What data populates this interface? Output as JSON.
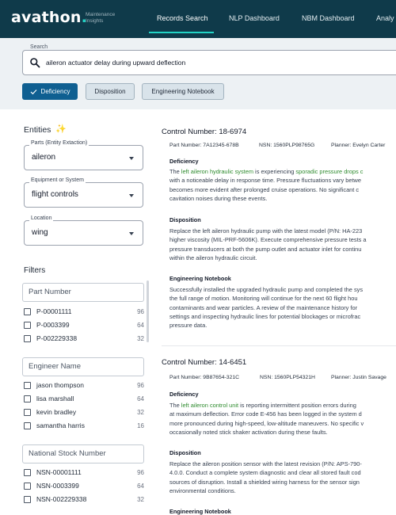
{
  "app": {
    "logo": "avathon",
    "logo_dot": ".",
    "subtitle_line1": "Maintenance",
    "subtitle_line2": "Insights"
  },
  "nav": {
    "tabs": [
      {
        "label": "Records Search",
        "active": true
      },
      {
        "label": "NLP Dashboard",
        "active": false
      },
      {
        "label": "NBM Dashboard",
        "active": false
      },
      {
        "label": "Analy",
        "active": false
      }
    ],
    "accent_color": "#22d3c5"
  },
  "search": {
    "label": "Search",
    "value": "aileron actuator delay during upward deflection",
    "icon": "search-icon"
  },
  "chips": [
    {
      "label": "Deficiency",
      "selected": true,
      "icon": "check-icon"
    },
    {
      "label": "Disposition",
      "selected": false
    },
    {
      "label": "Engineering Notebook",
      "selected": false
    }
  ],
  "entities": {
    "title": "Entities",
    "icon": "sparkle-icon",
    "fields": [
      {
        "label": "Parts (Entity Extaction)",
        "value": "aileron"
      },
      {
        "label": "Equipment or System",
        "value": "flight controls"
      },
      {
        "label": "Location",
        "value": "wing"
      }
    ]
  },
  "filters": {
    "title": "Filters",
    "groups": [
      {
        "placeholder": "Part Number",
        "items": [
          {
            "label": "P-00001111",
            "count": "96"
          },
          {
            "label": "P-0003399",
            "count": "64"
          },
          {
            "label": "P-002229338",
            "count": "32"
          }
        ]
      },
      {
        "placeholder": "Engineer Name",
        "items": [
          {
            "label": "jason thompson",
            "count": "96"
          },
          {
            "label": "lisa marshall",
            "count": "64"
          },
          {
            "label": "kevin bradley",
            "count": "32"
          },
          {
            "label": "samantha harris",
            "count": "16"
          }
        ]
      },
      {
        "placeholder": "National Stock Number",
        "items": [
          {
            "label": "NSN-00001111",
            "count": "96"
          },
          {
            "label": "NSN-0003399",
            "count": "64"
          },
          {
            "label": "NSN-002229338",
            "count": "32"
          }
        ]
      }
    ]
  },
  "records": [
    {
      "title": "Control Number: 18-6974",
      "part_number": "Part Number: 7A12345-678B",
      "nsn": "NSN: 1560PLP98765G",
      "planner": "Planner: Evelyn Carter",
      "deficiency_heading": "Deficiency",
      "deficiency_pre": "The ",
      "deficiency_hl1": "left aileron hydraulic system",
      "deficiency_mid": " is experiencing ",
      "deficiency_hl2": "sporadic pressure drops c",
      "deficiency_lines": [
        "with a noticeable delay in response time. Pressure fluctuations vary betwe",
        "becomes more evident after prolonged cruise operations. No significant c",
        "cavitation noises during these events."
      ],
      "disposition_heading": "Disposition",
      "disposition_lines": [
        "Replace the left aileron hydraulic pump with the latest model (P/N: HA-223",
        "higher viscosity (MIL-PRF-5606K). Execute comprehensive pressure tests a",
        "pressure transducers at both the pump outlet and actuator inlet for continu",
        "within the aileron hydraulic circuit."
      ],
      "notebook_heading": "Engineering Notebook",
      "notebook_lines": [
        "Successfully installed the upgraded hydraulic pump and completed the sys",
        "the full range of motion. Monitoring will continue for the next 60 flight hou",
        "contaminants and wear particles. A review of the maintenance history for",
        "settings and inspecting hydraulic lines for potential blockages or microfrac",
        "pressure data."
      ]
    },
    {
      "title": "Control Number: 14-6451",
      "part_number": "Part Number: 9B87654-321C",
      "nsn": "NSN: 1560PLP54321H",
      "planner": "Planner: Justin Savage",
      "deficiency_heading": "Deficiency",
      "deficiency_pre": "The ",
      "deficiency_hl1": "left aileron control unit",
      "deficiency_post": " is reporting intermittent position errors during",
      "deficiency_lines": [
        "at maximum deflection. Error code E-456 has been logged in the system d",
        "more pronounced during high-speed, low-altitude maneuvers. No specific v",
        "occasionally noted stick shaker activation during these faults."
      ],
      "disposition_heading": "Disposition",
      "disposition_lines": [
        "Replace the aileron position sensor with the latest revision (P/N: APS-790-",
        "4.0.0. Conduct a complete system diagnostic and clear all stored fault cod",
        "sources of disruption. Install a shielded wiring harness for the sensor sign",
        "environmental conditions."
      ],
      "notebook_heading": "Engineering Notebook"
    }
  ]
}
